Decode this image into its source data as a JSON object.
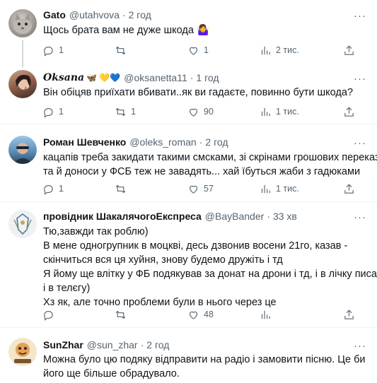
{
  "tweets": [
    {
      "name": "Gato",
      "handle": "@utahvova",
      "time": "2 год",
      "lines": [
        "Щось брата вам не дуже шкода 🤷‍♀️"
      ],
      "replies": "1",
      "retweets": "",
      "likes": "1",
      "views": "2 тис."
    },
    {
      "name": "𝑶𝒌𝒔𝒂𝒏𝒂",
      "name_suffix": "🦋 💛💙",
      "handle": "@oksanetta11",
      "time": "1 год",
      "lines": [
        "Він обіцяв приїхати вбивати..як ви гадаєте, повинно бути шкода?"
      ],
      "replies": "1",
      "retweets": "1",
      "likes": "90",
      "views": "1 тис."
    },
    {
      "name": "Роман Шевченко",
      "handle": "@oleks_roman",
      "time": "2 год",
      "lines": [
        "кацапів треба закидати такими смсками, зі скрінами грошових переказів",
        "та й доноси у ФСБ теж не завадять... хай їбуться жаби з гадюками"
      ],
      "replies": "1",
      "retweets": "",
      "likes": "57",
      "views": "1 тис."
    },
    {
      "name": "провідник ШакалячогоЕкспреса",
      "handle": "@BayBander",
      "time": "33 хв",
      "lines": [
        "Тю,завжди так роблю)",
        "В мене одногрупник в моцкві, десь дзвонив восени 21го, казав -",
        "скінчиться вся ця хуйня, знову будемо дружіть і тд",
        "Я йому ще влітку у ФБ подякував за донат на дрони і тд, і в лічку писав,",
        "і в телєгу)",
        "Хз як, але точно проблеми були в нього через це"
      ],
      "replies": "",
      "retweets": "",
      "likes": "48",
      "views": ""
    },
    {
      "name": "SunZhar",
      "handle": "@sun_zhar",
      "time": "2 год",
      "lines": [
        "Можна було цю подяку відправити на радіо і замовити пісню. Це би",
        "його ще більше обрадувало."
      ]
    }
  ],
  "separator": "·",
  "more_label": "···",
  "colors": {
    "text": "#0f1419",
    "muted": "#536471",
    "thread_line": "#cfd9de",
    "divider": "#eff3f4"
  }
}
